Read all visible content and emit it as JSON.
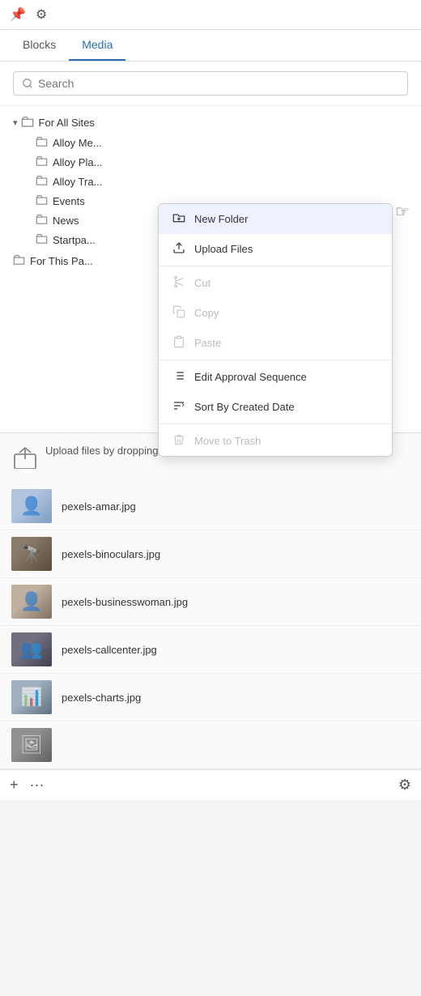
{
  "topbar": {
    "pin_icon": "📌",
    "gear_icon": "⚙"
  },
  "tabs": [
    {
      "id": "blocks",
      "label": "Blocks",
      "active": false
    },
    {
      "id": "media",
      "label": "Media",
      "active": true
    }
  ],
  "search": {
    "placeholder": "Search"
  },
  "tree": {
    "root_label": "For All Sites",
    "children": [
      {
        "label": "Alloy Me..."
      },
      {
        "label": "Alloy Pla..."
      },
      {
        "label": "Alloy Tra..."
      },
      {
        "label": "Events"
      },
      {
        "label": "News"
      },
      {
        "label": "Startpa..."
      }
    ],
    "for_this_page_label": "For This Pa..."
  },
  "context_menu": {
    "items": [
      {
        "id": "new-folder",
        "label": "New Folder",
        "icon": "folder-plus",
        "disabled": false,
        "highlighted": true
      },
      {
        "id": "upload-files",
        "label": "Upload Files",
        "icon": "upload",
        "disabled": false,
        "highlighted": false
      },
      {
        "id": "cut",
        "label": "Cut",
        "icon": "cut",
        "disabled": true,
        "highlighted": false
      },
      {
        "id": "copy",
        "label": "Copy",
        "icon": "copy",
        "disabled": true,
        "highlighted": false
      },
      {
        "id": "paste",
        "label": "Paste",
        "icon": "paste",
        "disabled": true,
        "highlighted": false
      },
      {
        "id": "edit-approval",
        "label": "Edit Approval Sequence",
        "icon": "list",
        "disabled": false,
        "highlighted": false
      },
      {
        "id": "sort-by-date",
        "label": "Sort By Created Date",
        "icon": "sort",
        "disabled": false,
        "highlighted": false
      },
      {
        "id": "move-to-trash",
        "label": "Move to Trash",
        "icon": "trash",
        "disabled": true,
        "highlighted": false
      }
    ]
  },
  "dropzone": {
    "text": "Upload files by dropping them here or click to browse"
  },
  "files": [
    {
      "id": "amar",
      "name": "pexels-amar.jpg",
      "thumb_class": "thumb-amar"
    },
    {
      "id": "binoculars",
      "name": "pexels-binoculars.jpg",
      "thumb_class": "thumb-bino"
    },
    {
      "id": "businesswoman",
      "name": "pexels-businesswoman.jpg",
      "thumb_class": "thumb-bw"
    },
    {
      "id": "callcenter",
      "name": "pexels-callcenter.jpg",
      "thumb_class": "thumb-cc"
    },
    {
      "id": "charts",
      "name": "pexels-charts.jpg",
      "thumb_class": "thumb-charts"
    },
    {
      "id": "extra",
      "name": "",
      "thumb_class": "thumb-extra"
    }
  ],
  "bottom_toolbar": {
    "add_label": "+",
    "more_label": "···",
    "gear_label": "⚙"
  }
}
